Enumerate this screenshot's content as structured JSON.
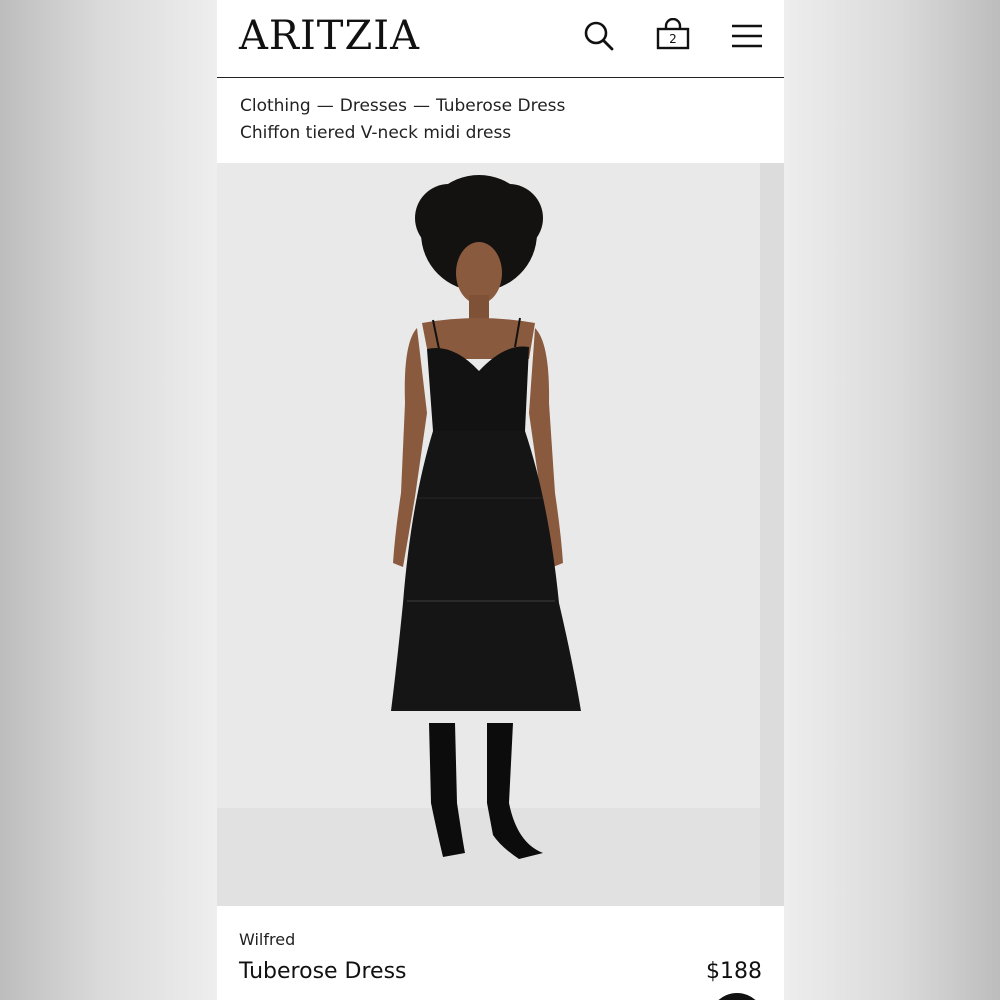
{
  "header": {
    "logo_text": "ARITZIA",
    "icons": [
      "search-icon",
      "shopping-bag-icon",
      "hamburger-menu-icon"
    ],
    "bag_count": "2"
  },
  "breadcrumb": {
    "items": [
      "Clothing",
      "Dresses",
      "Tuberose Dress"
    ],
    "separator": "—"
  },
  "product": {
    "subtitle": "Chiffon tiered V-neck midi dress",
    "brand": "Wilfred",
    "name": "Tuberose Dress",
    "price": "$188"
  },
  "colors": {
    "accent": "#111111",
    "background": "#ffffff",
    "photo_backdrop": "#e9e9ea"
  }
}
